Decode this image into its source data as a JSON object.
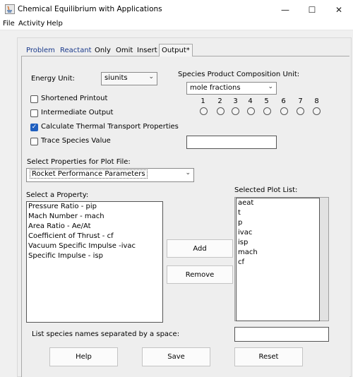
{
  "window": {
    "title": "Chemical Equilibrium with Applications",
    "controls": {
      "minimize": "—",
      "maximize": "☐",
      "close": "✕"
    }
  },
  "menubar": {
    "items": [
      "File",
      "Activity",
      "Help"
    ]
  },
  "tabs": [
    "Problem",
    "Reactant",
    "Only",
    "Omit",
    "Insert",
    "Output*"
  ],
  "energy_unit": {
    "label": "Energy Unit:",
    "value": "siunits"
  },
  "species_comp_unit": {
    "label": "Species Product Composition Unit:",
    "value": "mole fractions"
  },
  "radio_numbers": [
    "1",
    "2",
    "3",
    "4",
    "5",
    "6",
    "7",
    "8"
  ],
  "checkboxes": [
    {
      "label": "Shortened Printout",
      "checked": false
    },
    {
      "label": "Intermediate Output",
      "checked": false
    },
    {
      "label": "Calculate Thermal Transport Properties",
      "checked": true
    },
    {
      "label": "Trace Species Value",
      "checked": false
    }
  ],
  "plot_file": {
    "label": "Select Properties for Plot File:",
    "value": "Rocket Performance Parameters"
  },
  "select_property": {
    "label": "Select a Property:",
    "items": [
      "Pressure Ratio - pip",
      "Mach Number - mach",
      "Area Ratio - Ae/At",
      "Coefficient of Thrust - cf",
      "Vacuum Specific Impulse -ivac",
      "Specific Impulse - isp"
    ]
  },
  "selected_plot_list": {
    "label": "Selected Plot List:",
    "items": [
      "aeat",
      "t",
      "p",
      "ivac",
      "isp",
      "mach",
      "cf"
    ]
  },
  "buttons": {
    "add": "Add",
    "remove": "Remove",
    "help": "Help",
    "save": "Save",
    "reset": "Reset"
  },
  "species_names": {
    "label": "List species names separated by a space:",
    "value": ""
  },
  "checkmark": "✓",
  "dropdown_arrow": "⌄"
}
